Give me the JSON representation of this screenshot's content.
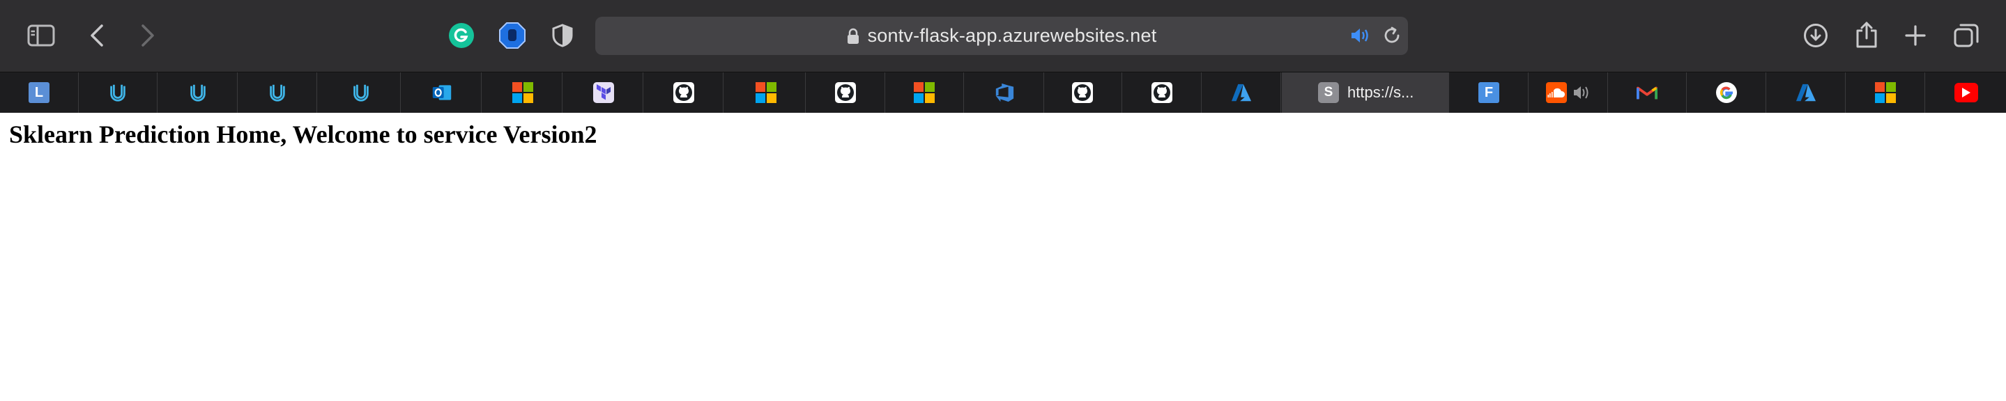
{
  "browser": {
    "url": "sontv-flask-app.azurewebsites.net",
    "toolbar_icons": [
      "sidebar-icon",
      "back-icon",
      "forward-icon",
      "grammarly-icon",
      "hand-shield-icon",
      "privacy-shield-icon",
      "download-icon",
      "share-icon",
      "new-tab-icon",
      "tab-overview-icon"
    ],
    "colors": {
      "toolbar": "#2f2e30",
      "urlbar": "#444346",
      "tabbar": "#1d1d1f",
      "active_tab": "#3c3b3e"
    }
  },
  "tabs": [
    {
      "icon": "letter-l-icon",
      "letter": "L",
      "bg": "#5b8fd6"
    },
    {
      "icon": "udacity-icon"
    },
    {
      "icon": "udacity-icon"
    },
    {
      "icon": "udacity-icon"
    },
    {
      "icon": "udacity-icon"
    },
    {
      "icon": "outlook-icon"
    },
    {
      "icon": "microsoft-icon"
    },
    {
      "icon": "terraform-icon"
    },
    {
      "icon": "github-icon"
    },
    {
      "icon": "microsoft-icon"
    },
    {
      "icon": "github-icon"
    },
    {
      "icon": "microsoft-icon"
    },
    {
      "icon": "azure-devops-icon"
    },
    {
      "icon": "github-icon"
    },
    {
      "icon": "github-icon"
    },
    {
      "icon": "azure-icon"
    },
    {
      "icon": "letter-s-icon",
      "letter": "S",
      "title": "https://s...",
      "active": true
    },
    {
      "icon": "letter-f-icon",
      "letter": "F",
      "bg": "#4a90e2"
    },
    {
      "icon": "soundcloud-icon"
    },
    {
      "icon": "gmail-icon"
    },
    {
      "icon": "google-icon"
    },
    {
      "icon": "azure-icon"
    },
    {
      "icon": "microsoft-icon"
    },
    {
      "icon": "youtube-icon"
    }
  ],
  "page": {
    "heading": "Sklearn Prediction Home, Welcome to service Version2"
  }
}
